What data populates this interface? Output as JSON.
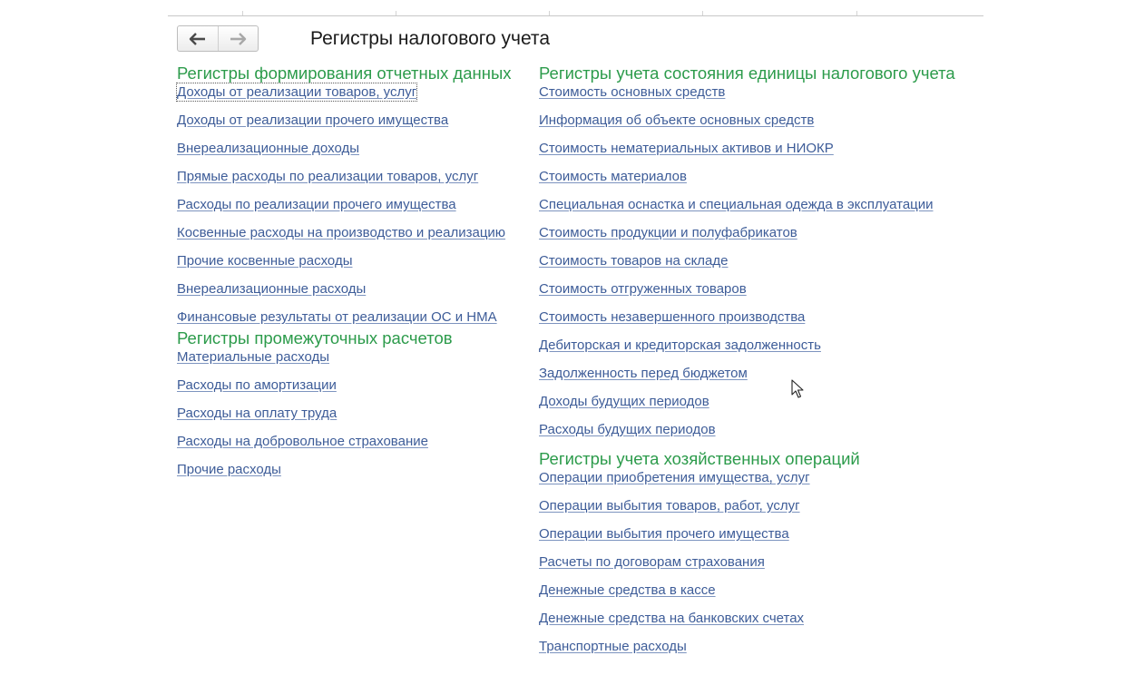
{
  "header": {
    "title": "Регистры налогового учета",
    "back_icon": "arrow-left-icon",
    "forward_icon": "arrow-right-icon"
  },
  "left_column": {
    "groups": [
      {
        "title": "Регистры формирования отчетных данных",
        "items": [
          "Доходы от реализации товаров, услуг",
          "Доходы от реализации прочего имущества",
          "Внереализационные доходы",
          "Прямые расходы по реализации товаров, услуг",
          "Расходы по реализации прочего имущества",
          "Косвенные расходы на производство и реализацию",
          "Прочие косвенные расходы",
          "Внереализационные расходы",
          "Финансовые результаты от реализации ОС и НМА"
        ]
      },
      {
        "title": "Регистры промежуточных расчетов",
        "items": [
          "Материальные расходы",
          "Расходы по амортизации",
          "Расходы на оплату труда",
          "Расходы на добровольное страхование",
          "Прочие расходы"
        ]
      }
    ]
  },
  "right_column": {
    "groups": [
      {
        "title": "Регистры учета состояния единицы налогового учета",
        "items": [
          "Стоимость основных средств",
          "Информация об объекте основных средств",
          "Стоимость нематериальных активов и НИОКР",
          "Стоимость материалов",
          "Специальная оснастка и специальная одежда в эксплуатации",
          "Стоимость продукции и полуфабрикатов",
          "Стоимость товаров на складе",
          "Стоимость отгруженных товаров",
          "Стоимость незавершенного производства",
          "Дебиторская и кредиторская задолженность",
          "Задолженность перед бюджетом",
          "Доходы будущих периодов",
          "Расходы будущих периодов"
        ]
      },
      {
        "title": "Регистры учета хозяйственных операций",
        "items": [
          "Операции приобретения имущества, услуг",
          "Операции выбытия товаров, работ, услуг",
          "Операции выбытия прочего имущества",
          "Расчеты по договорам страхования",
          "Денежные средства в кассе",
          "Денежные средства на банковских счетах",
          "Транспортные расходы"
        ]
      }
    ]
  },
  "colors": {
    "group_title": "#2c9b4b",
    "link": "#3d5c98"
  }
}
